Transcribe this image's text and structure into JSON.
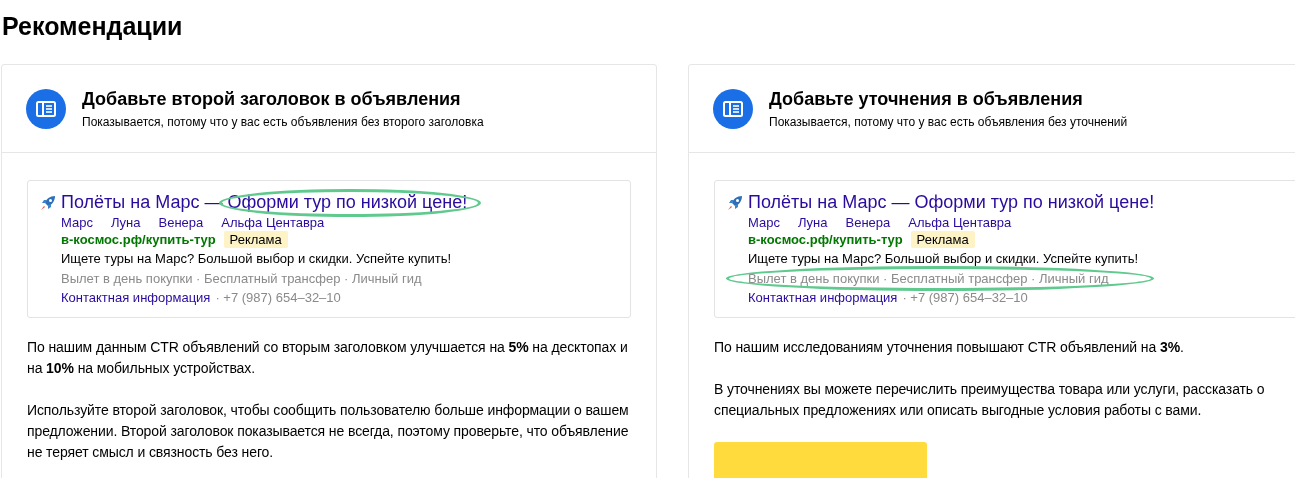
{
  "page_title": "Рекомендации",
  "cards": [
    {
      "title": "Добавьте второй заголовок в объявления",
      "subtitle": "Показывается, потому что у вас есть объявления без второго заголовка",
      "ad": {
        "title1": "Полёты на Марс —",
        "title2": {
          "text": "Оформи тур по низкой цене!",
          "highlighted": true
        },
        "sitelinks": [
          "Марс",
          "Луна",
          "Венера",
          "Альфа Центавра"
        ],
        "domain": "в-космос.рф/купить-тур",
        "badge": "Реклама",
        "text": "Ищете туры на Марс? Большой выбор и скидки. Успейте купить!",
        "callouts": {
          "text": "Вылет в день покупки · Бесплатный трансфер · Личный гид",
          "highlighted": false
        },
        "contact": "Контактная информация",
        "phone": "· +7 (987) 654–32–10"
      },
      "paragraphs": [
        "По нашим данным CTR объявлений со вторым заголовком улучшается на **5%** на десктопах и на **10%** на мобильных устройствах.",
        "Используйте второй заголовок, чтобы сообщить пользователю больше информации о вашем предложении. Второй заголовок показывается не всегда, поэтому проверьте, что объявление не теряет смысл и связность без него."
      ]
    },
    {
      "title": "Добавьте уточнения в объявления",
      "subtitle": "Показывается, потому что у вас есть объявления без уточнений",
      "ad": {
        "title1": "Полёты на Марс —",
        "title2": {
          "text": "Оформи тур по низкой цене!",
          "highlighted": false
        },
        "sitelinks": [
          "Марс",
          "Луна",
          "Венера",
          "Альфа Центавра"
        ],
        "domain": "в-космос.рф/купить-тур",
        "badge": "Реклама",
        "text": "Ищете туры на Марс? Большой выбор и скидки. Успейте купить!",
        "callouts": {
          "text": "Вылет в день покупки · Бесплатный трансфер · Личный гид",
          "highlighted": true
        },
        "contact": "Контактная информация",
        "phone": "· +7 (987) 654–32–10"
      },
      "paragraphs": [
        "По нашим исследованиям уточнения повышают CTR объявлений на **3%**.",
        "В уточнениях вы можете перечислить преимущества товара или услуги, рассказать о специальных предложениях или описать выгодные условия работы с вами."
      ],
      "button": true
    }
  ]
}
